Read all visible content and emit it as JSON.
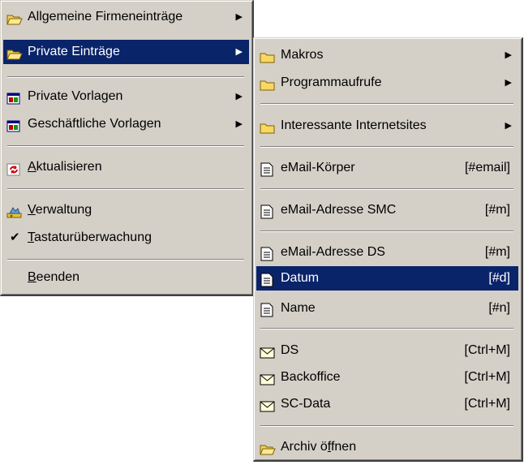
{
  "main_menu": {
    "items": [
      {
        "label": "Allgemeine Firmeneinträge",
        "arrow": "▶"
      },
      {
        "label": "Private Einträge",
        "arrow": "▶"
      },
      {
        "label": "Private Vorlagen",
        "arrow": "▶"
      },
      {
        "label": "Geschäftliche Vorlagen",
        "arrow": "▶"
      },
      {
        "label_mnemonic": "A",
        "label_rest": "ktualisieren"
      },
      {
        "label_mnemonic": "V",
        "label_rest": "erwaltung"
      },
      {
        "label_mnemonic": "T",
        "label_rest": "astaturüberwachung",
        "check": "✔"
      },
      {
        "label_mnemonic": "B",
        "label_rest": "eenden"
      }
    ]
  },
  "sub_menu": {
    "items": [
      {
        "label": "Makros",
        "arrow": "▶"
      },
      {
        "label": "Programmaufrufe",
        "arrow": "▶"
      },
      {
        "label": "Interessante Internetsites",
        "arrow": "▶"
      },
      {
        "label": "eMail-Körper",
        "shortcut": "[#email]"
      },
      {
        "label": "eMail-Adresse SMC",
        "shortcut": "[#m]"
      },
      {
        "label": "eMail-Adresse DS",
        "shortcut": "[#m]"
      },
      {
        "label": "Datum",
        "shortcut": "[#d]"
      },
      {
        "label": "Name",
        "shortcut": "[#n]"
      },
      {
        "label": "DS",
        "shortcut": "[Ctrl+M]"
      },
      {
        "label": "Backoffice",
        "shortcut": "[Ctrl+M]"
      },
      {
        "label": "SC-Data",
        "shortcut": "[Ctrl+M]"
      },
      {
        "label_pre": "Archiv ö",
        "label_mnemonic": "f",
        "label_rest": "fnen"
      }
    ]
  },
  "colors": {
    "menu_bg": "#d4d0c8",
    "highlight": "#0a246a",
    "highlight_text": "#ffffff"
  },
  "icons": {
    "folder_open": "folder-open-icon",
    "folder": "folder-icon",
    "template": "template-icon",
    "refresh": "refresh-icon",
    "admin": "admin-icon",
    "document": "document-icon",
    "mail": "envelope-icon"
  }
}
